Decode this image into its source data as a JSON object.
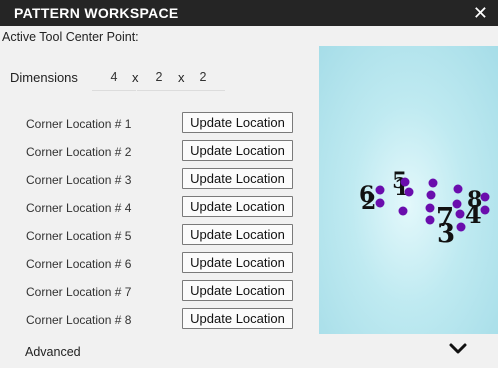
{
  "window": {
    "title": "PATTERN WORKSPACE",
    "close_icon": "close-icon"
  },
  "tool_center": {
    "label": "Active Tool Center Point:"
  },
  "dimensions": {
    "label": "Dimensions",
    "x": "4",
    "y": "2",
    "z": "2",
    "separator": "x"
  },
  "corners": [
    {
      "label": "Corner Location # 1",
      "button": "Update Location"
    },
    {
      "label": "Corner Location # 2",
      "button": "Update Location"
    },
    {
      "label": "Corner Location # 3",
      "button": "Update Location"
    },
    {
      "label": "Corner Location # 4",
      "button": "Update Location"
    },
    {
      "label": "Corner Location # 5",
      "button": "Update Location"
    },
    {
      "label": "Corner Location # 6",
      "button": "Update Location"
    },
    {
      "label": "Corner Location # 7",
      "button": "Update Location"
    },
    {
      "label": "Corner Location # 8",
      "button": "Update Location"
    }
  ],
  "advanced": {
    "label": "Advanced",
    "icon": "chevron-down-icon"
  },
  "viewport": {
    "background_color": "#bfeaf1",
    "point_color": "#6a0dad",
    "corner_numbers": [
      "6",
      "2",
      "5",
      "1",
      "7",
      "3",
      "8",
      "4"
    ]
  }
}
